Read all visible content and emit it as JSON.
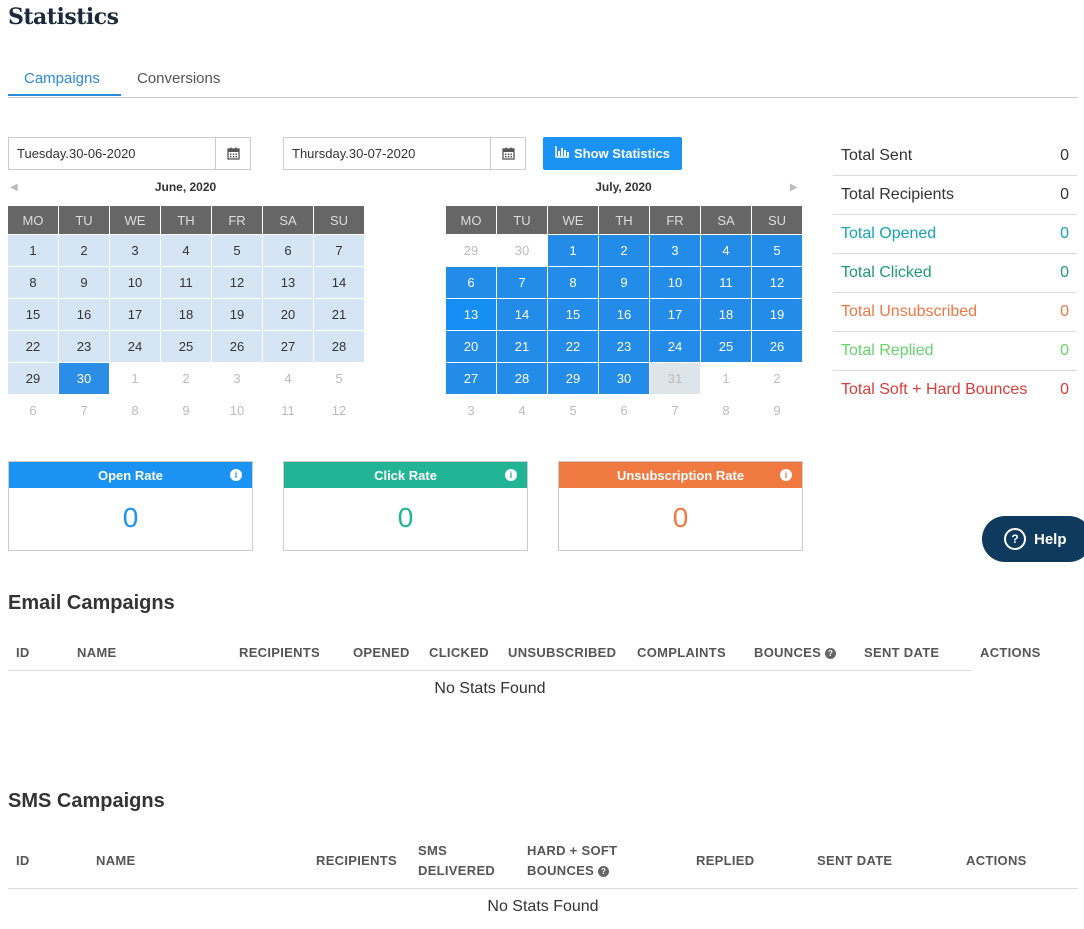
{
  "page": {
    "title": "Statistics"
  },
  "tabs": [
    {
      "label": "Campaigns",
      "active": true
    },
    {
      "label": "Conversions",
      "active": false
    }
  ],
  "filters": {
    "start_date": "Tuesday.30-06-2020",
    "end_date": "Thursday.30-07-2020",
    "show_button": "Show Statistics",
    "calendar_icon": "calendar-icon",
    "chart_icon": "bar-chart-icon"
  },
  "calendars": {
    "weekdays": [
      "MO",
      "TU",
      "WE",
      "TH",
      "FR",
      "SA",
      "SU"
    ],
    "left": {
      "title": "June, 2020",
      "nav_prev": "◀",
      "weeks": [
        [
          "1",
          "2",
          "3",
          "4",
          "5",
          "6",
          "7"
        ],
        [
          "8",
          "9",
          "10",
          "11",
          "12",
          "13",
          "14"
        ],
        [
          "15",
          "16",
          "17",
          "18",
          "19",
          "20",
          "21"
        ],
        [
          "22",
          "23",
          "24",
          "25",
          "26",
          "27",
          "28"
        ],
        [
          "29",
          "30",
          "1",
          "2",
          "3",
          "4",
          "5"
        ],
        [
          "6",
          "7",
          "8",
          "9",
          "10",
          "11",
          "12"
        ]
      ]
    },
    "right": {
      "title": "July, 2020",
      "nav_next": "▶",
      "weeks": [
        [
          "29",
          "30",
          "1",
          "2",
          "3",
          "4",
          "5"
        ],
        [
          "6",
          "7",
          "8",
          "9",
          "10",
          "11",
          "12"
        ],
        [
          "13",
          "14",
          "15",
          "16",
          "17",
          "18",
          "19"
        ],
        [
          "20",
          "21",
          "22",
          "23",
          "24",
          "25",
          "26"
        ],
        [
          "27",
          "28",
          "29",
          "30",
          "31",
          "1",
          "2"
        ],
        [
          "3",
          "4",
          "5",
          "6",
          "7",
          "8",
          "9"
        ]
      ]
    }
  },
  "totals": [
    {
      "label": "Total Sent",
      "value": "0",
      "color": "#333333"
    },
    {
      "label": "Total Recipients",
      "value": "0",
      "color": "#333333"
    },
    {
      "label": "Total Opened",
      "value": "0",
      "color": "#17a2b8"
    },
    {
      "label": "Total Clicked",
      "value": "0",
      "color": "#1e9b74"
    },
    {
      "label": "Total Unsubscribed",
      "value": "0",
      "color": "#ee7744"
    },
    {
      "label": "Total Replied",
      "value": "0",
      "color": "#66d46b"
    },
    {
      "label": "Total Soft + Hard Bounces",
      "value": "0",
      "color": "#d43f3a"
    }
  ],
  "rates": [
    {
      "label": "Open Rate",
      "value": "0",
      "color": "#1a93f4"
    },
    {
      "label": "Click Rate",
      "value": "0",
      "color": "#22b595"
    },
    {
      "label": "Unsubscription Rate",
      "value": "0",
      "color": "#f07941"
    }
  ],
  "help": {
    "label": "Help"
  },
  "email_campaigns": {
    "title": "Email Campaigns",
    "columns": [
      "ID",
      "NAME",
      "RECIPIENTS",
      "OPENED",
      "CLICKED",
      "UNSUBSCRIBED",
      "COMPLAINTS",
      "BOUNCES",
      "SENT DATE",
      "ACTIONS"
    ],
    "empty": "No Stats Found"
  },
  "sms_campaigns": {
    "title": "SMS Campaigns",
    "columns": [
      "ID",
      "NAME",
      "RECIPIENTS",
      "SMS",
      "DELIVERED",
      "HARD + SOFT",
      "BOUNCES",
      "REPLIED",
      "SENT DATE",
      "ACTIONS"
    ],
    "empty": "No Stats Found"
  }
}
